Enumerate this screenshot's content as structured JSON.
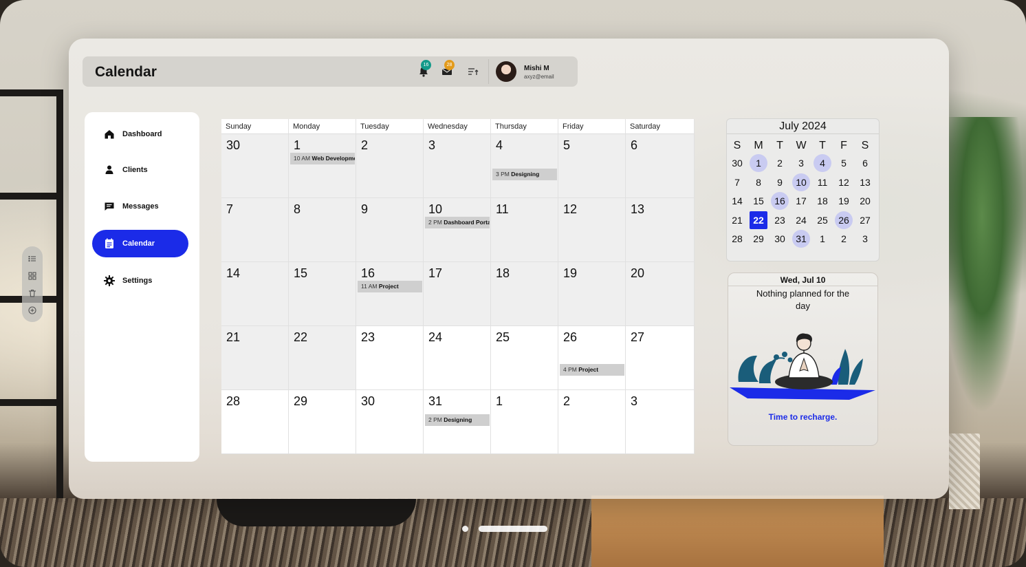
{
  "header": {
    "title": "Calendar",
    "notifications_count": "16",
    "messages_count": "28",
    "user_name": "Mishi M",
    "user_email": "axyz@email"
  },
  "sidebar": {
    "items": [
      {
        "label": "Dashboard",
        "icon": "home-icon"
      },
      {
        "label": "Clients",
        "icon": "user-icon"
      },
      {
        "label": "Messages",
        "icon": "chat-icon"
      },
      {
        "label": "Calendar",
        "icon": "calendar-icon",
        "active": true
      },
      {
        "label": "Settings",
        "icon": "gear-icon"
      }
    ]
  },
  "toolbar": {
    "icons": [
      "list-icon",
      "grid-icon",
      "trash-icon",
      "add-icon"
    ]
  },
  "month": {
    "weekdays": [
      "Sunday",
      "Monday",
      "Tuesday",
      "Wednesday",
      "Thursday",
      "Friday",
      "Saturday"
    ],
    "weeks": [
      [
        {
          "d": "30",
          "shaded": true
        },
        {
          "d": "1",
          "shaded": true,
          "event": {
            "time": "10 AM",
            "name": "Web Development"
          }
        },
        {
          "d": "2",
          "shaded": true
        },
        {
          "d": "3",
          "shaded": true
        },
        {
          "d": "4",
          "shaded": true,
          "event": {
            "time": "3 PM",
            "name": "Designing"
          }
        },
        {
          "d": "5",
          "shaded": true
        },
        {
          "d": "6",
          "shaded": true
        }
      ],
      [
        {
          "d": "7",
          "shaded": true
        },
        {
          "d": "8",
          "shaded": true
        },
        {
          "d": "9",
          "shaded": true
        },
        {
          "d": "10",
          "shaded": true,
          "event": {
            "time": "2 PM",
            "name": "Dashboard Portal"
          }
        },
        {
          "d": "11",
          "shaded": true
        },
        {
          "d": "12",
          "shaded": true
        },
        {
          "d": "13",
          "shaded": true
        }
      ],
      [
        {
          "d": "14",
          "shaded": true
        },
        {
          "d": "15",
          "shaded": true
        },
        {
          "d": "16",
          "shaded": true,
          "event": {
            "time": "11 AM",
            "name": "Project"
          }
        },
        {
          "d": "17",
          "shaded": true
        },
        {
          "d": "18",
          "shaded": true
        },
        {
          "d": "19",
          "shaded": true
        },
        {
          "d": "20",
          "shaded": true
        }
      ],
      [
        {
          "d": "21",
          "shaded": true
        },
        {
          "d": "22",
          "shaded": true
        },
        {
          "d": "23",
          "shaded": false
        },
        {
          "d": "24",
          "shaded": false
        },
        {
          "d": "25",
          "shaded": false
        },
        {
          "d": "26",
          "shaded": false,
          "event": {
            "time": "4 PM",
            "name": "Project"
          }
        },
        {
          "d": "27",
          "shaded": false
        }
      ],
      [
        {
          "d": "28",
          "shaded": false
        },
        {
          "d": "29",
          "shaded": false
        },
        {
          "d": "30",
          "shaded": false
        },
        {
          "d": "31",
          "shaded": false,
          "event": {
            "time": "2 PM",
            "name": "Designing"
          }
        },
        {
          "d": "1",
          "shaded": false
        },
        {
          "d": "2",
          "shaded": false
        },
        {
          "d": "3",
          "shaded": false
        }
      ]
    ]
  },
  "mini_calendar": {
    "title": "July 2024",
    "weekday_letters": [
      "S",
      "M",
      "T",
      "W",
      "T",
      "F",
      "S"
    ],
    "weeks": [
      [
        "30",
        "1",
        "2",
        "3",
        "4",
        "5",
        "6"
      ],
      [
        "7",
        "8",
        "9",
        "10",
        "11",
        "12",
        "13"
      ],
      [
        "14",
        "15",
        "16",
        "17",
        "18",
        "19",
        "20"
      ],
      [
        "21",
        "22",
        "23",
        "24",
        "25",
        "26",
        "27"
      ],
      [
        "28",
        "29",
        "30",
        "31",
        "1",
        "2",
        "3"
      ]
    ],
    "highlighted": [
      [
        0,
        1
      ],
      [
        0,
        4
      ],
      [
        1,
        3
      ],
      [
        2,
        2
      ],
      [
        3,
        5
      ],
      [
        4,
        3
      ]
    ],
    "today": [
      3,
      1
    ]
  },
  "day_card": {
    "date": "Wed, Jul 10",
    "message": "Nothing planned for the day",
    "footer": "Time to recharge."
  },
  "colors": {
    "accent": "#1b2be8",
    "highlight": "#c9cbf1",
    "notif_badge": "#139a8a",
    "msg_badge": "#e39b1b",
    "illustration": "#1a5d7a"
  }
}
